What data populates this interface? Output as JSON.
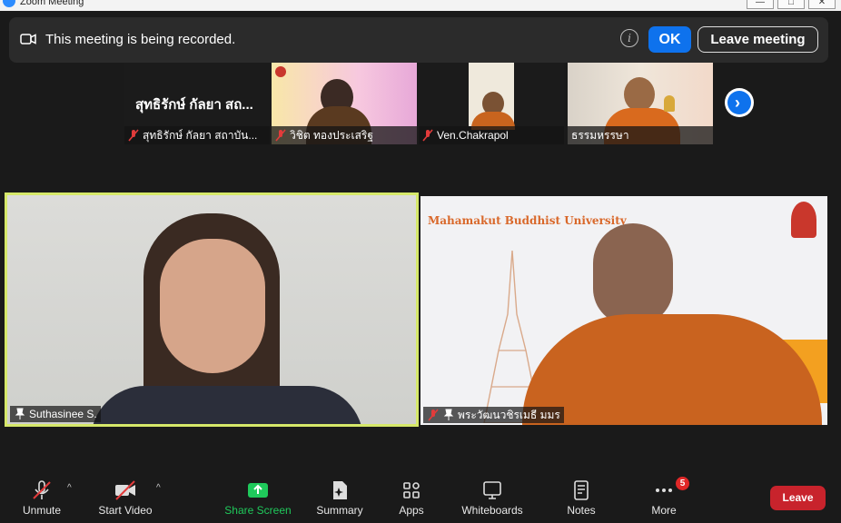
{
  "window": {
    "title": "Zoom Meeting"
  },
  "banner": {
    "message": "This meeting is being recorded.",
    "ok_label": "OK",
    "leave_meeting_label": "Leave meeting"
  },
  "thumbnails": [
    {
      "name": "สุทธิรักษ์ กัลยา สถาบัน...",
      "overlay": "สุทธิรักษ์ กัลยา สถ...",
      "muted": true
    },
    {
      "name": "วิชิต ทองประเสริฐ",
      "muted": true
    },
    {
      "name": "Ven.Chakrapol",
      "muted": true
    },
    {
      "name": "ธรรมหรรษา",
      "muted": false
    }
  ],
  "main_tiles": [
    {
      "name": "Suthasinee S.",
      "active_speaker": true
    },
    {
      "name": "พระวัฒนวชิรเมธี มมร",
      "background_text": "Mahamakut Buddhist University"
    }
  ],
  "toolbar": {
    "unmute": "Unmute",
    "start_video": "Start Video",
    "share_screen": "Share Screen",
    "summary": "Summary",
    "apps": "Apps",
    "whiteboards": "Whiteboards",
    "notes": "Notes",
    "more": "More",
    "more_badge": "5",
    "leave": "Leave"
  },
  "colors": {
    "accent": "#0e72ed",
    "share_green": "#1fc95b",
    "leave_red": "#c8232c",
    "active_border": "#d6e86a"
  }
}
